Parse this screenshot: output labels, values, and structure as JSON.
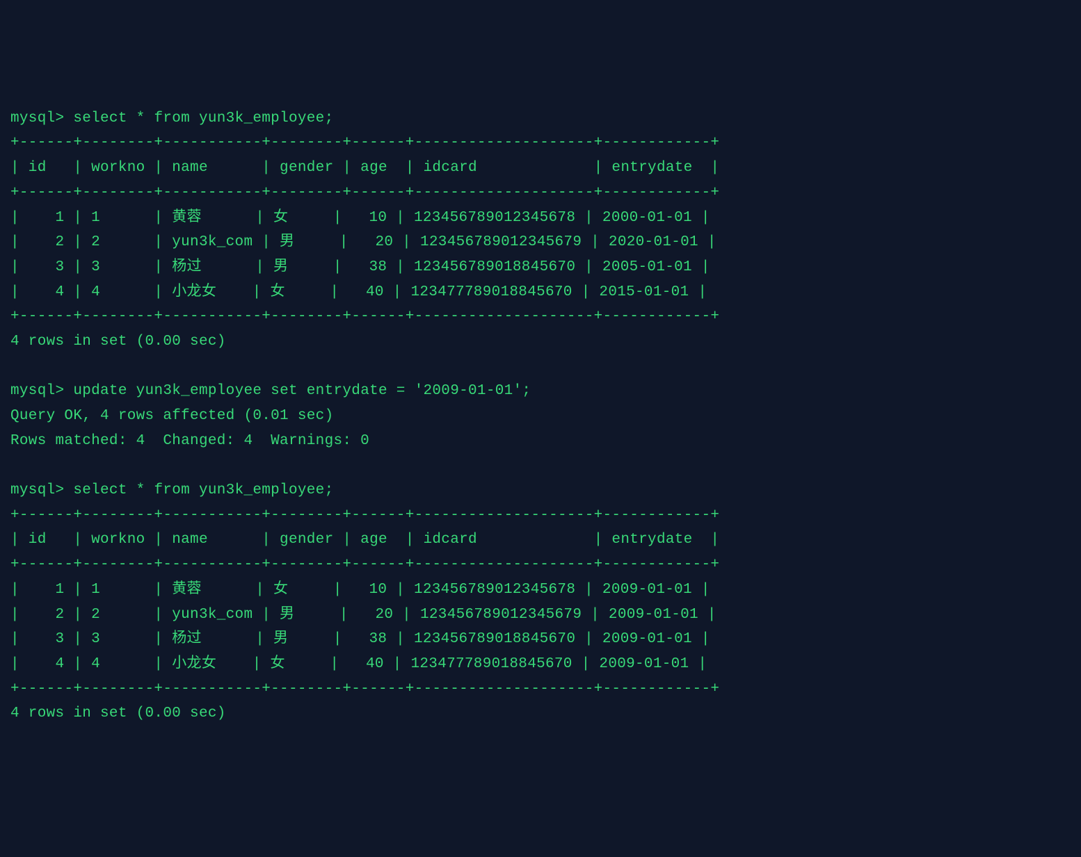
{
  "prompt": "mysql>",
  "queries": {
    "select1": "select * from yun3k_employee;",
    "update": "update yun3k_employee set entrydate = '2009-01-01';",
    "select2": "select * from yun3k_employee;"
  },
  "table1": {
    "border_top": "+------+--------+-----------+--------+------+--------------------+------------+",
    "header": "| id   | workno | name      | gender | age  | idcard             | entrydate  |",
    "border_mid": "+------+--------+-----------+--------+------+--------------------+------------+",
    "rows": [
      "|    1 | 1      | 黄蓉      | 女     |   10 | 123456789012345678 | 2000-01-01 |",
      "|    2 | 2      | yun3k_com | 男     |   20 | 123456789012345679 | 2020-01-01 |",
      "|    3 | 3      | 杨过      | 男     |   38 | 123456789018845670 | 2005-01-01 |",
      "|    4 | 4      | 小龙女    | 女     |   40 | 123477789018845670 | 2015-01-01 |"
    ],
    "border_bot": "+------+--------+-----------+--------+------+--------------------+------------+",
    "summary": "4 rows in set (0.00 sec)"
  },
  "update_result": {
    "line1": "Query OK, 4 rows affected (0.01 sec)",
    "line2": "Rows matched: 4  Changed: 4  Warnings: 0"
  },
  "table2": {
    "border_top": "+------+--------+-----------+--------+------+--------------------+------------+",
    "header": "| id   | workno | name      | gender | age  | idcard             | entrydate  |",
    "border_mid": "+------+--------+-----------+--------+------+--------------------+------------+",
    "rows": [
      "|    1 | 1      | 黄蓉      | 女     |   10 | 123456789012345678 | 2009-01-01 |",
      "|    2 | 2      | yun3k_com | 男     |   20 | 123456789012345679 | 2009-01-01 |",
      "|    3 | 3      | 杨过      | 男     |   38 | 123456789018845670 | 2009-01-01 |",
      "|    4 | 4      | 小龙女    | 女     |   40 | 123477789018845670 | 2009-01-01 |"
    ],
    "border_bot": "+------+--------+-----------+--------+------+--------------------+------------+",
    "summary": "4 rows in set (0.00 sec)"
  }
}
